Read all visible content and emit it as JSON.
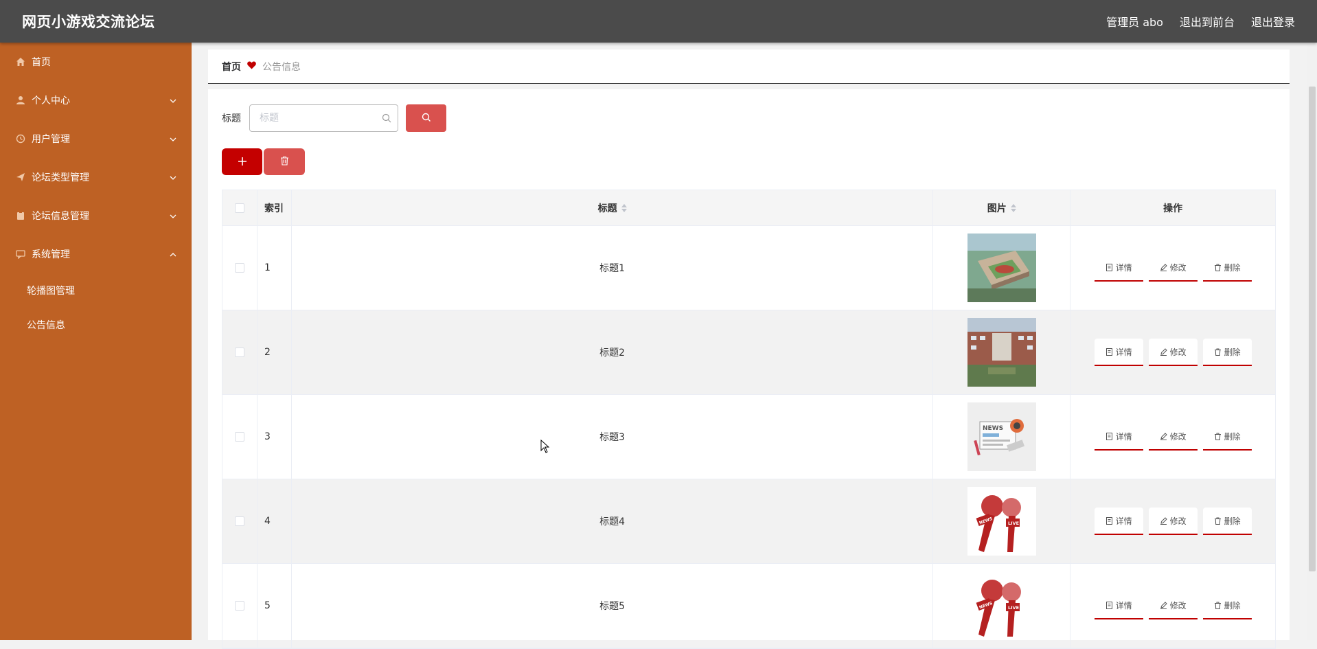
{
  "header": {
    "title": "网页小游戏交流论坛",
    "links": [
      "管理员 abo",
      "退出到前台",
      "退出登录"
    ]
  },
  "sidebar": {
    "items": [
      {
        "label": "首页",
        "icon": "home-icon",
        "chevron": ""
      },
      {
        "label": "个人中心",
        "icon": "user-icon",
        "chevron": "⌄"
      },
      {
        "label": "用户管理",
        "icon": "clock-icon",
        "chevron": "⌄"
      },
      {
        "label": "论坛类型管理",
        "icon": "send-icon",
        "chevron": "⌄"
      },
      {
        "label": "论坛信息管理",
        "icon": "clipboard-icon",
        "chevron": "⌄"
      },
      {
        "label": "系统管理",
        "icon": "chat-icon",
        "chevron": "⌃"
      }
    ],
    "subitems": [
      "轮播图管理",
      "公告信息"
    ]
  },
  "breadcrumb": {
    "home": "首页",
    "current": "公告信息"
  },
  "search": {
    "label": "标题",
    "placeholder": "标题"
  },
  "table": {
    "headers": {
      "index": "索引",
      "title": "标题",
      "image": "图片",
      "ops": "操作"
    },
    "rows": [
      {
        "index": "1",
        "title": "标题1",
        "image": "school-aerial-image"
      },
      {
        "index": "2",
        "title": "标题2",
        "image": "school-building-image"
      },
      {
        "index": "3",
        "title": "标题3",
        "image": "newspaper-image"
      },
      {
        "index": "4",
        "title": "标题4",
        "image": "live-microphone-image"
      },
      {
        "index": "5",
        "title": "标题5",
        "image": "live-microphone-image"
      }
    ],
    "ops": {
      "detail": "详情",
      "edit": "修改",
      "delete": "删除"
    }
  },
  "colors": {
    "header_bg": "#4b4b4b",
    "sidebar_bg": "#be6124",
    "accent": "#c40000",
    "accent_light": "#d9514e"
  }
}
